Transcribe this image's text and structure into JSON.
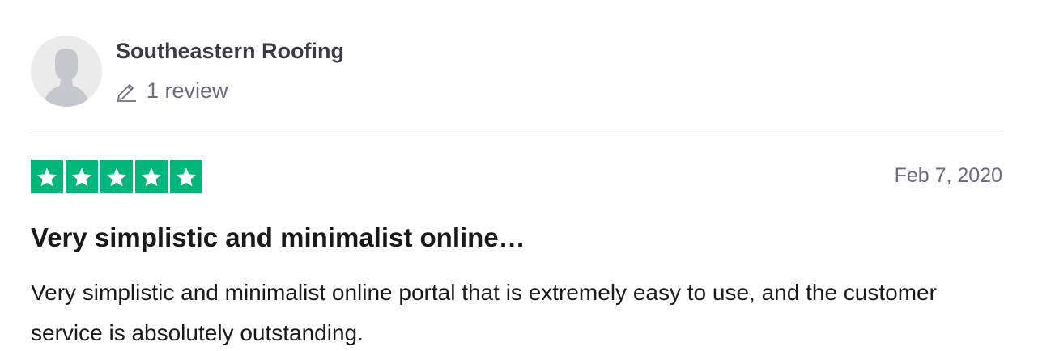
{
  "consumer": {
    "name": "Southeastern Roofing",
    "review_count_label": "1 review",
    "avatar_icon": "default-user-silhouette-icon"
  },
  "review": {
    "rating": 5,
    "rating_max": 5,
    "star_color": "#00b67a",
    "date": "Feb 7, 2020",
    "title": "Very simplistic and minimalist online…",
    "body": "Very simplistic and minimalist online portal that is extremely easy to use, and the customer service is absolutely outstanding."
  },
  "icons": {
    "pencil": "pencil-icon",
    "star": "star-icon"
  }
}
